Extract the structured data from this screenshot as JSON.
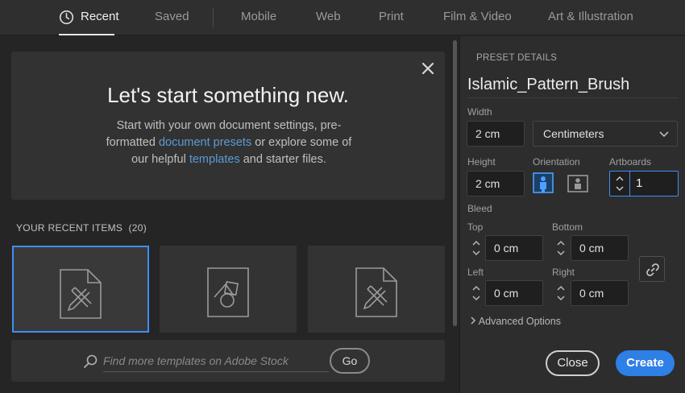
{
  "tabs": [
    {
      "label": "Recent"
    },
    {
      "label": "Saved"
    },
    {
      "label": "Mobile"
    },
    {
      "label": "Web"
    },
    {
      "label": "Print"
    },
    {
      "label": "Film & Video"
    },
    {
      "label": "Art & Illustration"
    }
  ],
  "welcome": {
    "title": "Let's start something new.",
    "text_1": "Start with your own document settings, pre-formatted ",
    "link_presets": "document presets",
    "text_2": " or explore some of our helpful ",
    "link_templates": "templates",
    "text_3": " and starter files."
  },
  "recent": {
    "label": "YOUR RECENT ITEMS",
    "count": "(20)"
  },
  "search": {
    "placeholder": "Find more templates on Adobe Stock",
    "go_label": "Go"
  },
  "preset": {
    "heading": "PRESET DETAILS",
    "name": "Islamic_Pattern_Brush",
    "width_label": "Width",
    "width_value": "2 cm",
    "units_value": "Centimeters",
    "height_label": "Height",
    "height_value": "2 cm",
    "orientation_label": "Orientation",
    "artboards_label": "Artboards",
    "artboards_value": "1",
    "bleed_label": "Bleed",
    "top_label": "Top",
    "top_value": "0 cm",
    "bottom_label": "Bottom",
    "bottom_value": "0 cm",
    "left_label": "Left",
    "left_value": "0 cm",
    "right_label": "Right",
    "right_value": "0 cm",
    "advanced_label": "Advanced Options",
    "close_label": "Close",
    "create_label": "Create"
  },
  "colors": {
    "accent": "#2e7fe6",
    "link": "#5b9bd5",
    "background": "#252525"
  }
}
